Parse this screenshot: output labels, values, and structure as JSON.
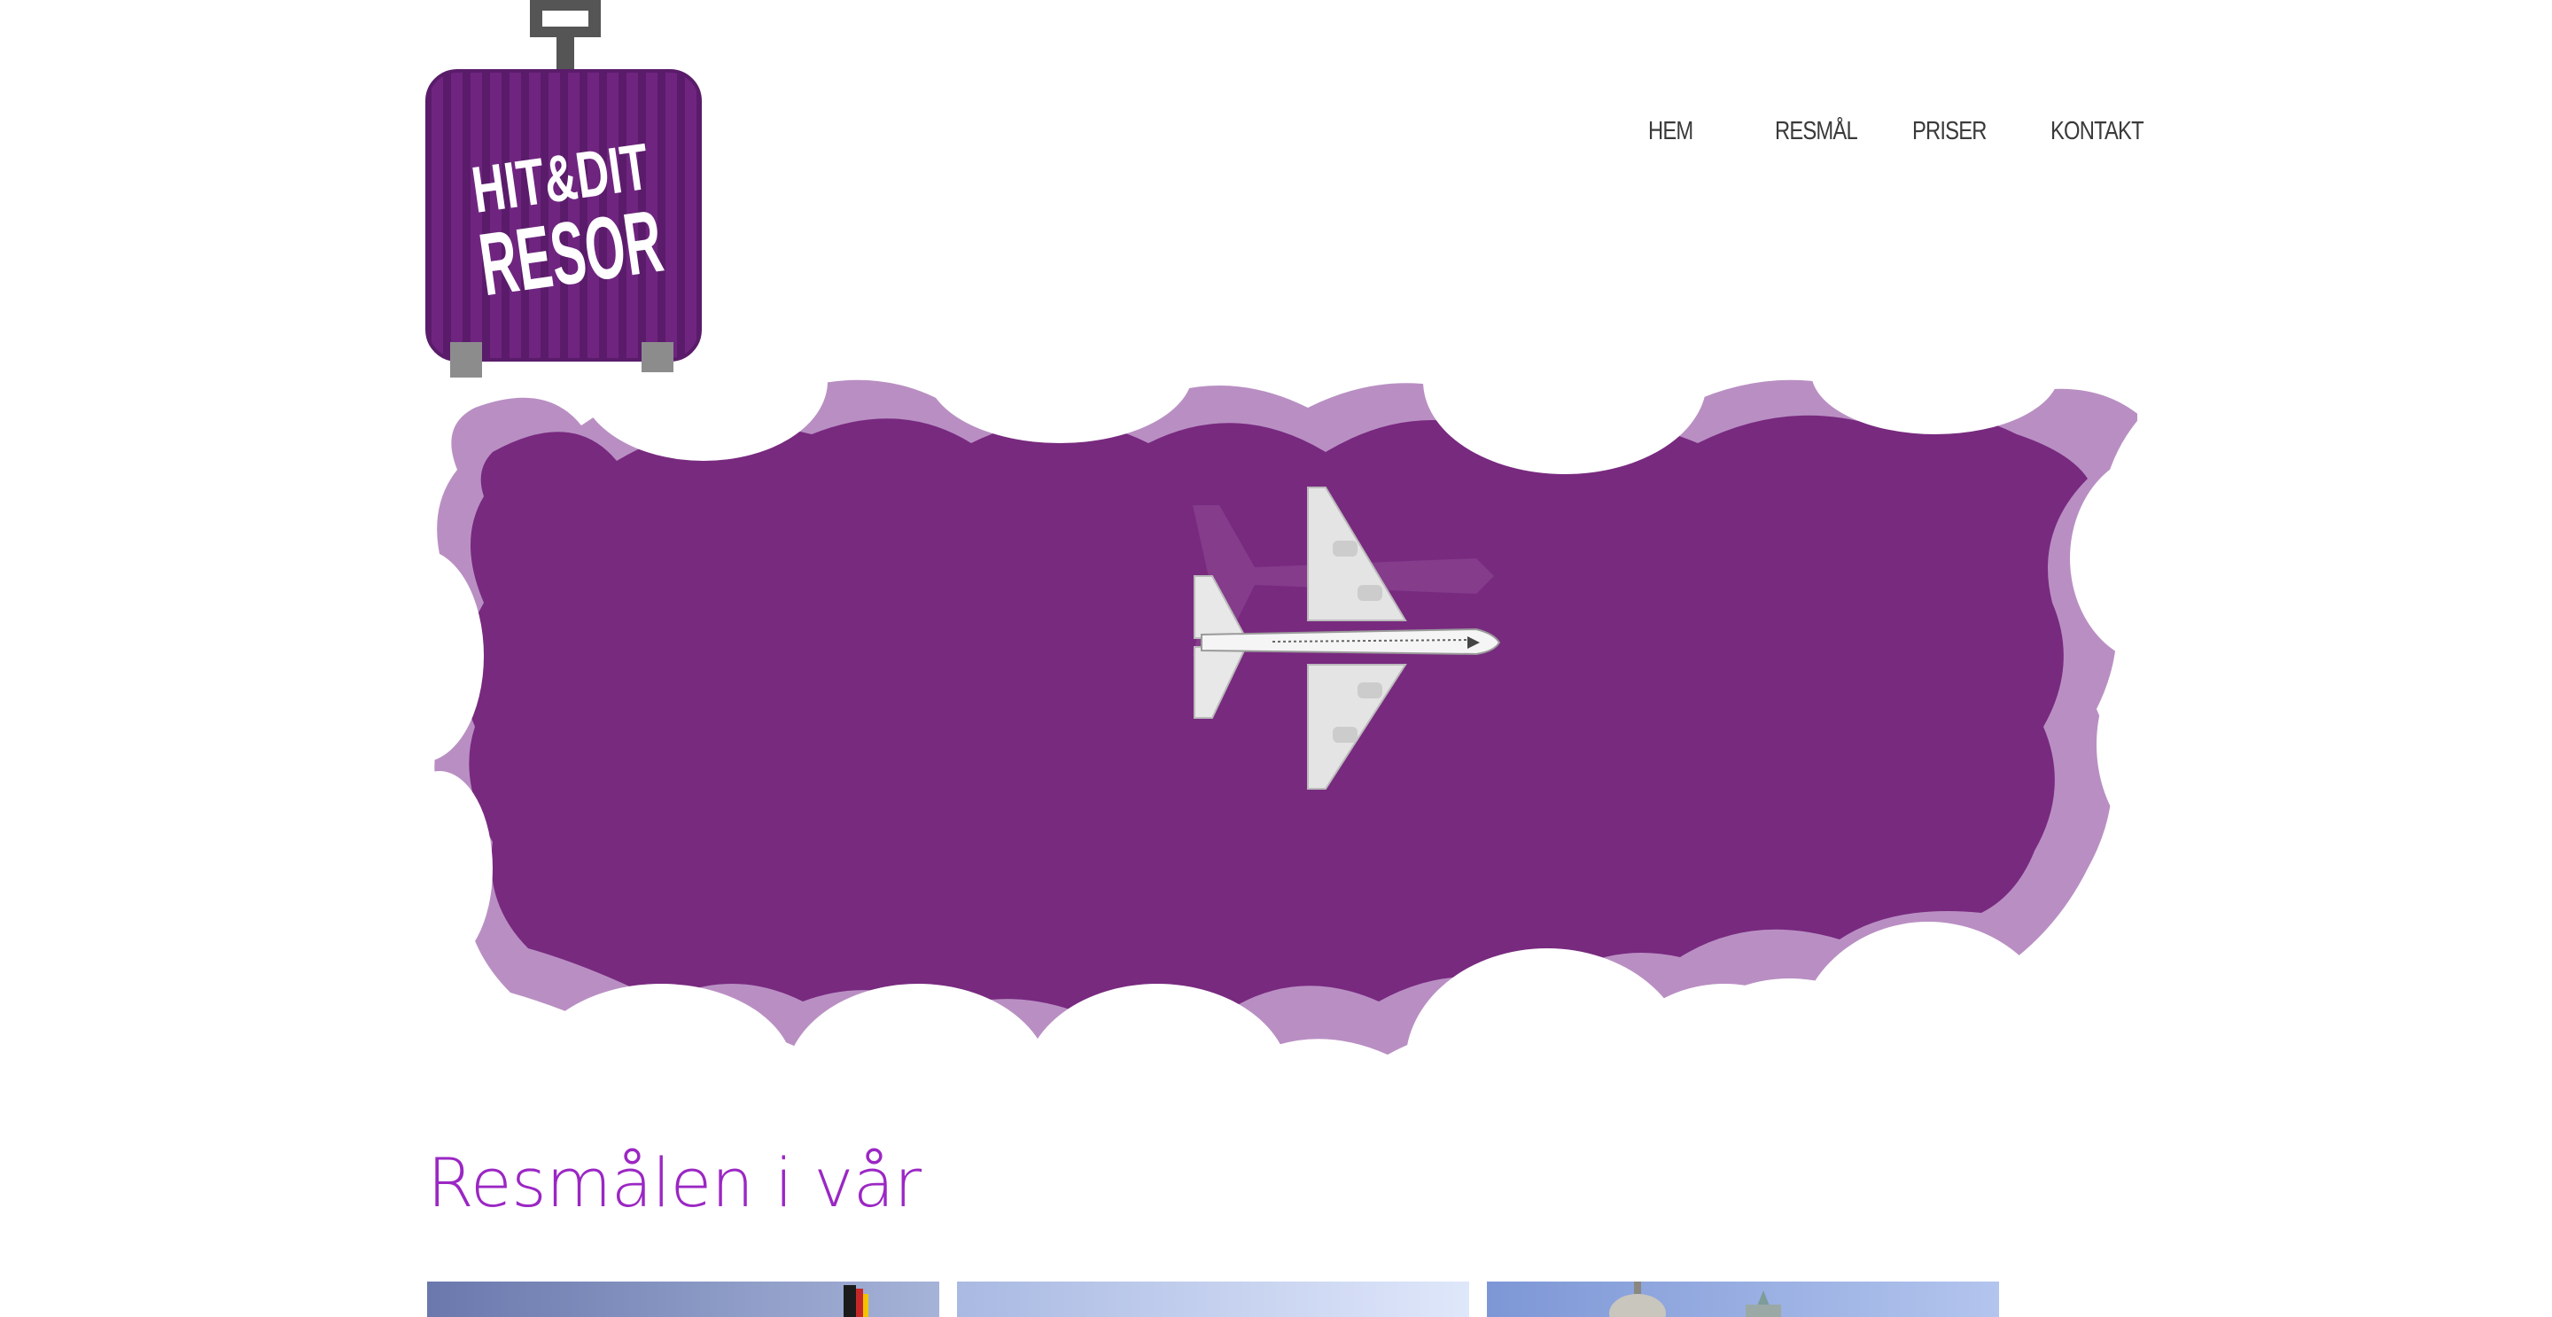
{
  "logo": {
    "line1": "HIT&DIT",
    "line2": "RESOR",
    "colors": {
      "body": "#6f2580",
      "stripe": "#5c1d6c",
      "handle": "#555555",
      "wheel": "#8c8c8c"
    }
  },
  "nav": {
    "items": [
      {
        "label": "HEM"
      },
      {
        "label": "RESMÅL"
      },
      {
        "label": "PRISER"
      },
      {
        "label": "KONTAKT"
      }
    ]
  },
  "hero": {
    "icon": "airplane-icon",
    "colors": {
      "cloud": "#7b2a7f",
      "cloud_edge": "#b88ec2",
      "plane": "#e8e8e8"
    }
  },
  "main": {
    "heading": "Resmålen i vår",
    "heading_color": "#9b27c4",
    "cards": [
      {
        "image": "city-with-flag"
      },
      {
        "image": "sky-landscape"
      },
      {
        "image": "domed-building"
      }
    ]
  }
}
